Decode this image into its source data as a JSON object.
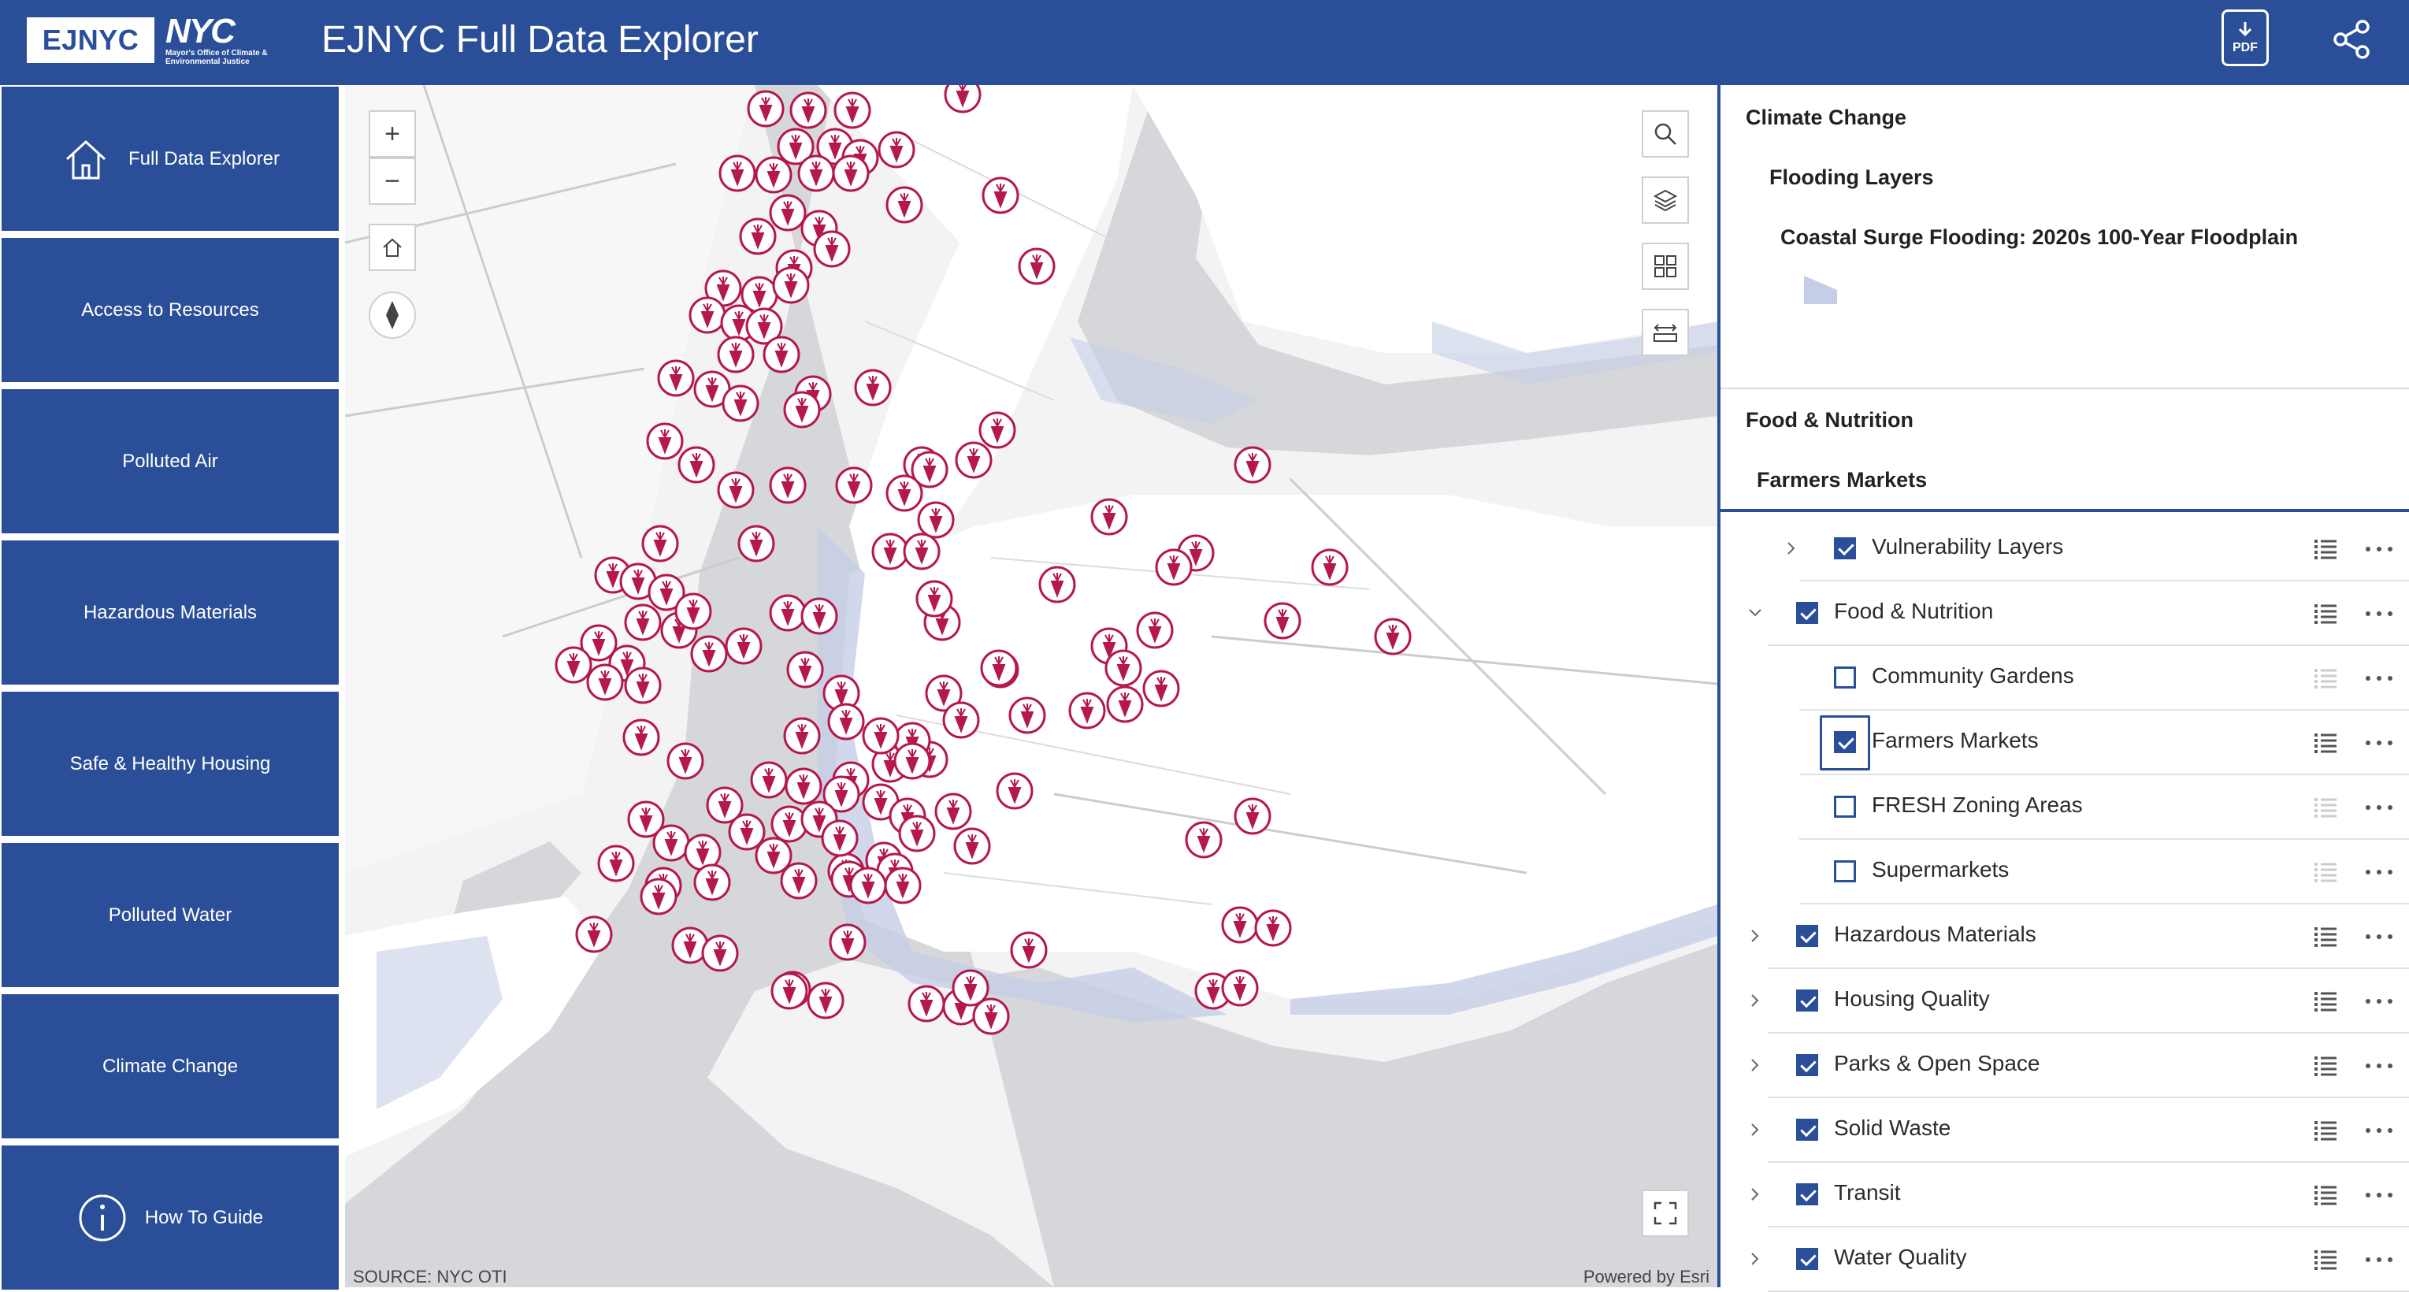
{
  "header": {
    "logo_ejnyc": "EJNYC",
    "logo_nyc": "NYC",
    "logo_nyc_sub": "Mayor's Office of Climate & Environmental Justice",
    "title": "EJNYC Full Data Explorer",
    "pdf_label": "PDF",
    "pdf_icon": "pdf-download-icon",
    "share_icon": "share-icon"
  },
  "sidebar": {
    "items": [
      {
        "label": "Full Data Explorer",
        "icon": "home-icon"
      },
      {
        "label": "Access to Resources"
      },
      {
        "label": "Polluted Air"
      },
      {
        "label": "Hazardous Materials"
      },
      {
        "label": "Safe & Healthy Housing"
      },
      {
        "label": "Polluted Water"
      },
      {
        "label": "Climate Change"
      },
      {
        "label": "How To Guide",
        "icon": "info-icon"
      }
    ]
  },
  "map": {
    "zoom_in": "+",
    "zoom_out": "−",
    "source": "SOURCE: NYC OTI",
    "powered_by": "Powered by Esri",
    "marker_icon": "carrot-marker-icon",
    "marker_color": "#b5174f",
    "flood_color": "#c5cee6",
    "tools": [
      "search-icon",
      "layers-icon",
      "basemap-gallery-icon",
      "measure-icon",
      "fullscreen-icon"
    ]
  },
  "legend": {
    "group1": "Climate Change",
    "subgroup1": "Flooding Layers",
    "layer1": "Coastal Surge Flooding: 2020s 100-Year Floodplain",
    "group2": "Food & Nutrition",
    "layer2": "Farmers Markets"
  },
  "layers": [
    {
      "label": "Vulnerability Layers",
      "checked": true,
      "level": 1,
      "expand": "collapsed"
    },
    {
      "label": "Food & Nutrition",
      "checked": true,
      "level": 0,
      "expand": "expanded"
    },
    {
      "label": "Community Gardens",
      "checked": false,
      "level": 1,
      "expand": "none"
    },
    {
      "label": "Farmers Markets",
      "checked": true,
      "level": 1,
      "expand": "none",
      "focused": true
    },
    {
      "label": "FRESH Zoning Areas",
      "checked": false,
      "level": 1,
      "expand": "none"
    },
    {
      "label": "Supermarkets",
      "checked": false,
      "level": 1,
      "expand": "none"
    },
    {
      "label": "Hazardous Materials",
      "checked": true,
      "level": 0,
      "expand": "collapsed"
    },
    {
      "label": "Housing Quality",
      "checked": true,
      "level": 0,
      "expand": "collapsed"
    },
    {
      "label": "Parks & Open Space",
      "checked": true,
      "level": 0,
      "expand": "collapsed"
    },
    {
      "label": "Solid Waste",
      "checked": true,
      "level": 0,
      "expand": "collapsed"
    },
    {
      "label": "Transit",
      "checked": true,
      "level": 0,
      "expand": "collapsed"
    },
    {
      "label": "Water Quality",
      "checked": true,
      "level": 0,
      "expand": "collapsed"
    }
  ]
}
